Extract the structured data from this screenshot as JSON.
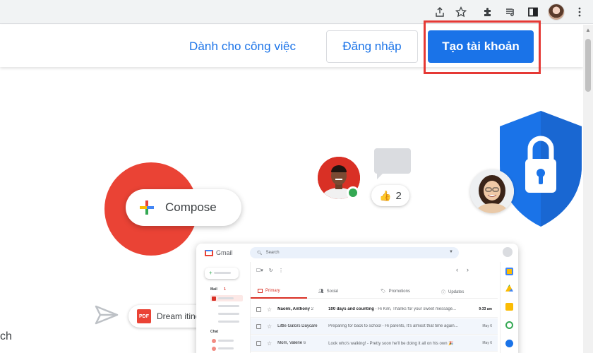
{
  "header": {
    "business_link": "Dành cho công việc",
    "login_button": "Đăng nhập",
    "signup_button": "Tạo tài khoản"
  },
  "hero": {
    "compose_label": "Compose",
    "like_count": "2",
    "attachment_label": "Dream itinerary",
    "attachment_type": "PDF",
    "cut_text": "ch"
  },
  "gmail": {
    "app_name": "Gmail",
    "search_placeholder": "Search",
    "side": {
      "mail_label": "Mail",
      "mail_badge": "1",
      "chat_label": "Chat"
    },
    "tabs": [
      "Primary",
      "Social",
      "Promotions",
      "Updates"
    ],
    "rows": [
      {
        "sender": "Naomi, Anthony",
        "count": "2",
        "subject": "100 days and counting",
        "snippet": " - Hi Kim, Thanks for your sweet message...",
        "time": "9:33 am"
      },
      {
        "sender": "Little Gators Daycare",
        "count": "",
        "subject": "",
        "snippet": "Preparing for back to school - Hi parents, It's almost that time again...",
        "time": "May 6"
      },
      {
        "sender": "Mom, Valerie",
        "count": "6",
        "subject": "",
        "snippet": "Look who's walking! - Pretty soon he'll be doing it all on his own 🎉",
        "time": "May 6"
      }
    ]
  },
  "colors": {
    "accent": "#1a73e8",
    "highlight": "#e53935",
    "compose_red": "#ea4335",
    "shield_blue": "#1a73e8"
  }
}
